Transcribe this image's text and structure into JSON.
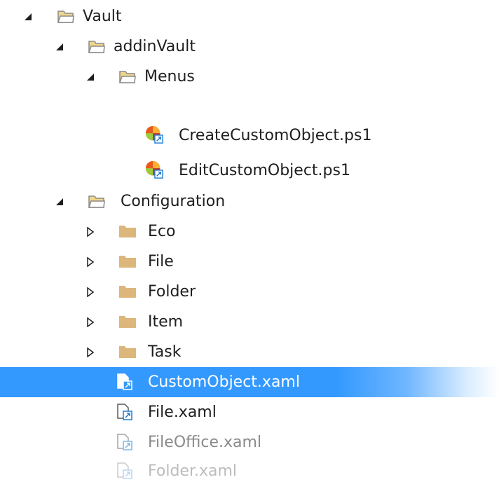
{
  "tree": {
    "vault": {
      "label": "Vault",
      "expander": "expanded-triangle-icon"
    },
    "addinVault": {
      "label": "addinVault",
      "expander": "expanded-triangle-icon"
    },
    "menus": {
      "label": "Menus",
      "expander": "expanded-triangle-icon"
    },
    "scripts": [
      {
        "label": "CreateCustomObject.ps1",
        "icon": "powershell-script-icon"
      },
      {
        "label": "EditCustomObject.ps1",
        "icon": "powershell-script-icon"
      }
    ],
    "configuration": {
      "label": "Configuration",
      "expander": "expanded-triangle-icon"
    },
    "config_folders": [
      {
        "label": "Eco",
        "icon": "folder-icon",
        "expander": "collapsed-triangle-icon"
      },
      {
        "label": "File",
        "icon": "folder-icon",
        "expander": "collapsed-triangle-icon"
      },
      {
        "label": "Folder",
        "icon": "folder-icon",
        "expander": "collapsed-triangle-icon"
      },
      {
        "label": "Item",
        "icon": "folder-icon",
        "expander": "collapsed-triangle-icon"
      },
      {
        "label": "Task",
        "icon": "folder-icon",
        "expander": "collapsed-triangle-icon"
      }
    ],
    "xaml_files": [
      {
        "label": "CustomObject.xaml",
        "icon": "xaml-file-icon",
        "selected": true
      },
      {
        "label": "File.xaml",
        "icon": "xaml-file-icon"
      },
      {
        "label": "FileOffice.xaml",
        "icon": "xaml-file-icon"
      },
      {
        "label": "Folder.xaml",
        "icon": "xaml-file-icon"
      }
    ]
  },
  "colors": {
    "selection": "#3399ff",
    "folder_open": "#f0d68b",
    "folder_closed": "#dcb67a",
    "text": "#1e1e1e"
  }
}
